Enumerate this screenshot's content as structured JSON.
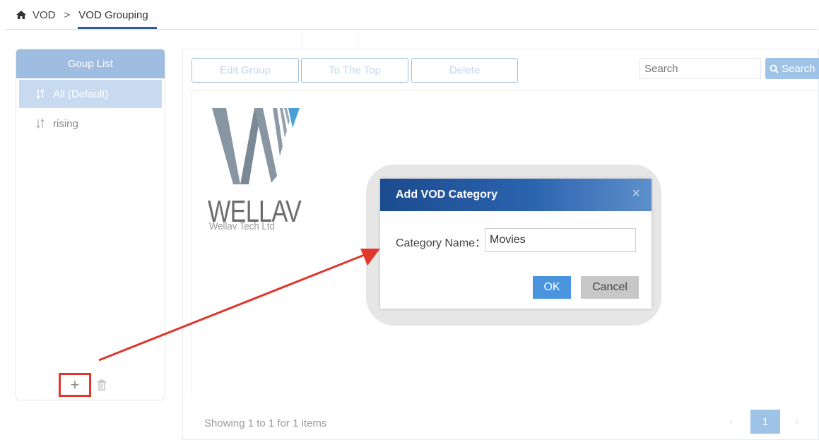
{
  "breadcrumb": {
    "home_icon": "home-icon",
    "root": "VOD",
    "separator": ">",
    "current": "VOD Grouping"
  },
  "group_list": {
    "title": "Goup List",
    "items": [
      {
        "label": "All (Default)",
        "active": true,
        "icon": "sort-icon"
      },
      {
        "label": "rising",
        "active": false,
        "icon": "sort-icon"
      }
    ],
    "add_label": "+",
    "delete_icon": "trash-icon"
  },
  "toolbar": {
    "edit_group": "Edit Group",
    "to_the_top": "To The Top",
    "delete": "Delete",
    "search_placeholder": "Search",
    "search_button": "Search"
  },
  "content": {
    "logo_word": "WELLAV",
    "logo_sub": "Wellav Tech Ltd"
  },
  "footer": {
    "showing": "Showing 1 to 1 for 1 items",
    "prev": "‹",
    "page": "1",
    "next": "›"
  },
  "modal": {
    "title": "Add VOD Category",
    "close": "×",
    "label": "Category Name：",
    "value": "Movies",
    "ok": "OK",
    "cancel": "Cancel"
  },
  "colors": {
    "accent": "#2f5c9c",
    "panel_header": "#9fbde1",
    "annotation": "#e0362b"
  }
}
